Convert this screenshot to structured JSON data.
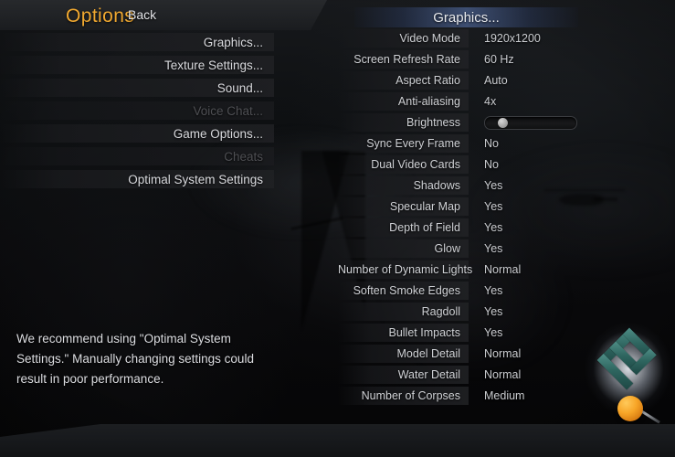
{
  "title": "Options",
  "menu": {
    "items": [
      {
        "label": "Graphics...",
        "enabled": true
      },
      {
        "label": "Texture Settings...",
        "enabled": true
      },
      {
        "label": "Sound...",
        "enabled": true
      },
      {
        "label": "Voice Chat...",
        "enabled": false
      },
      {
        "label": "Game Options...",
        "enabled": true
      },
      {
        "label": "Cheats",
        "enabled": false
      },
      {
        "label": "Optimal System Settings",
        "enabled": true
      }
    ]
  },
  "recommendation": "We recommend using \"Optimal System Settings.\"  Manually changing settings could result in poor performance.",
  "panel": {
    "header": "Graphics...",
    "settings": [
      {
        "label": "Video Mode",
        "value": "1920x1200",
        "type": "value"
      },
      {
        "label": "Screen Refresh Rate",
        "value": "60 Hz",
        "type": "value"
      },
      {
        "label": "Aspect Ratio",
        "value": "Auto",
        "type": "value"
      },
      {
        "label": "Anti-aliasing",
        "value": "4x",
        "type": "value"
      },
      {
        "label": "Brightness",
        "value": "",
        "type": "slider",
        "slider_percent": 16
      },
      {
        "label": "Sync Every Frame",
        "value": "No",
        "type": "value"
      },
      {
        "label": "Dual Video Cards",
        "value": "No",
        "type": "value"
      },
      {
        "label": "Shadows",
        "value": "Yes",
        "type": "value"
      },
      {
        "label": "Specular Map",
        "value": "Yes",
        "type": "value"
      },
      {
        "label": "Depth of Field",
        "value": "Yes",
        "type": "value"
      },
      {
        "label": "Glow",
        "value": "Yes",
        "type": "value"
      },
      {
        "label": "Number of Dynamic Lights",
        "value": "Normal",
        "type": "value"
      },
      {
        "label": "Soften Smoke Edges",
        "value": "Yes",
        "type": "value"
      },
      {
        "label": "Ragdoll",
        "value": "Yes",
        "type": "value"
      },
      {
        "label": "Bullet Impacts",
        "value": "Yes",
        "type": "value"
      },
      {
        "label": "Model Detail",
        "value": "Normal",
        "type": "value"
      },
      {
        "label": "Water Detail",
        "value": "Normal",
        "type": "value"
      },
      {
        "label": "Number of Corpses",
        "value": "Medium",
        "type": "value"
      }
    ]
  },
  "footer": {
    "back_label": "Back"
  },
  "colors": {
    "title_accent": "#f0a830",
    "header_blue": "#4a608e",
    "text_primary": "#d9dade",
    "text_disabled": "#4e4f53",
    "logo_teal": "#2f6660",
    "logo_orange": "#f7a527"
  }
}
